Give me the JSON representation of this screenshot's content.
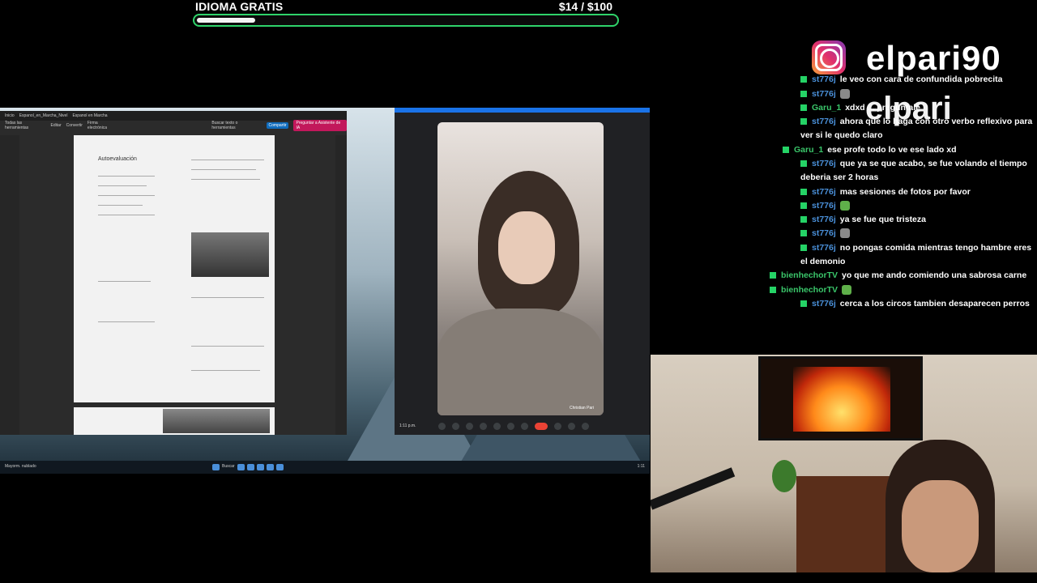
{
  "goal": {
    "title": "IDIOMA GRATIS",
    "amount": "$14  / $100",
    "progress": 0.14,
    "bar_color": "#2fd36a"
  },
  "screen_share": {
    "pdf_viewer": {
      "tabs": [
        "Inicio",
        "Espanol_en_Marcha_Nivel",
        "Espanol en Marcha"
      ],
      "toolbar": [
        "Todas las herramientas",
        "Editar",
        "Convertir",
        "Firma electrónica"
      ],
      "search": "Buscar texto o herramientas",
      "share_button": "Compartir",
      "ai_button": "Preguntar a Asistente de IA",
      "page_heading": "Autoevaluación"
    },
    "video_call": {
      "participant": "Christian Pari",
      "time": "1:11 p.m."
    },
    "taskbar": {
      "search": "Buscar",
      "weather": "Mayorm. nublado",
      "clock": "1:11"
    }
  },
  "instagram": {
    "icon": "instagram-icon",
    "handle": "elpari90",
    "ghost_text": "elpari"
  },
  "chat": {
    "messages": [
      {
        "user": "st776j",
        "text": "le veo con cara de confundida pobrecita",
        "emote": ""
      },
      {
        "user": "st776j",
        "text": "",
        "emote": "cat"
      },
      {
        "user": "Garu_1",
        "text": "xdxd ... preguntale",
        "emote": ""
      },
      {
        "user": "st776j",
        "text": "ahora que lo haga con otro verbo reflexivo para ver si le quedo claro",
        "emote": ""
      },
      {
        "user": "Garu_1",
        "text": "ese profe todo lo ve ese lado xd",
        "emote": ""
      },
      {
        "user": "st776j",
        "text": "que ya se que acabo, se fue volando el tiempo deberia ser 2 horas",
        "emote": ""
      },
      {
        "user": "st776j",
        "text": "mas sesiones de fotos por favor",
        "emote": ""
      },
      {
        "user": "st776j",
        "text": "",
        "emote": "frog"
      },
      {
        "user": "st776j",
        "text": "ya se fue que tristeza",
        "emote": ""
      },
      {
        "user": "st776j",
        "text": "",
        "emote": "cat"
      },
      {
        "user": "st776j",
        "text": "no pongas comida mientras tengo hambre eres el demonio",
        "emote": ""
      },
      {
        "user": "bienhechorTV",
        "text": "yo que me ando comiendo una sabrosa carne",
        "emote": ""
      },
      {
        "user": "bienhechorTV",
        "text": "",
        "emote": "frog"
      },
      {
        "user": "st776j",
        "text": "cerca a los circos tambien desaparecen perros",
        "emote": ""
      }
    ]
  }
}
